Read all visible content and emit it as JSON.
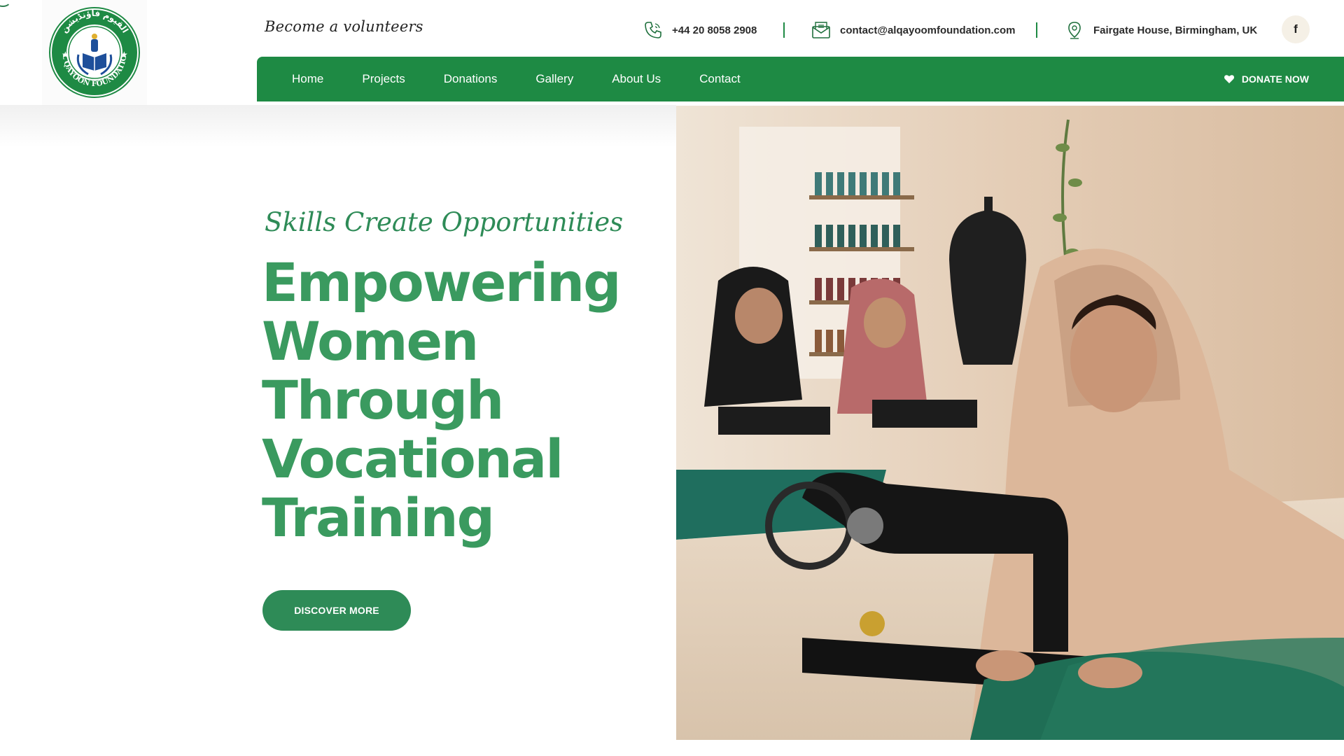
{
  "header": {
    "logo_text": "AL QAYOON FOUNDATION",
    "logo_arabic": "القيوم فاؤنڈیشن",
    "tagline": "Become a volunteers",
    "contacts": {
      "phone": "+44 20 8058 2908",
      "email": "contact@alqayoomfoundation.com",
      "address": "Fairgate House, Birmingham, UK"
    },
    "social": {
      "facebook_glyph": "f"
    }
  },
  "nav": {
    "items": [
      {
        "label": "Home"
      },
      {
        "label": "Projects"
      },
      {
        "label": "Donations"
      },
      {
        "label": "Gallery"
      },
      {
        "label": "About Us"
      },
      {
        "label": "Contact"
      }
    ],
    "donate_label": "DONATE NOW"
  },
  "hero": {
    "subtitle": "Skills Create Opportunities",
    "title_lines": [
      "Empowering",
      "Women",
      "Through",
      "Vocational",
      "Training"
    ],
    "button_label": "DISCOVER MORE"
  },
  "icons": {
    "phone": "phone-icon",
    "email": "envelope-icon",
    "location": "map-pin-icon",
    "facebook": "facebook-icon",
    "heart": "heart-icon"
  },
  "colors": {
    "brand_green": "#1e8a44",
    "hero_green": "#3a9a5f",
    "button_green": "#2e8b57"
  }
}
